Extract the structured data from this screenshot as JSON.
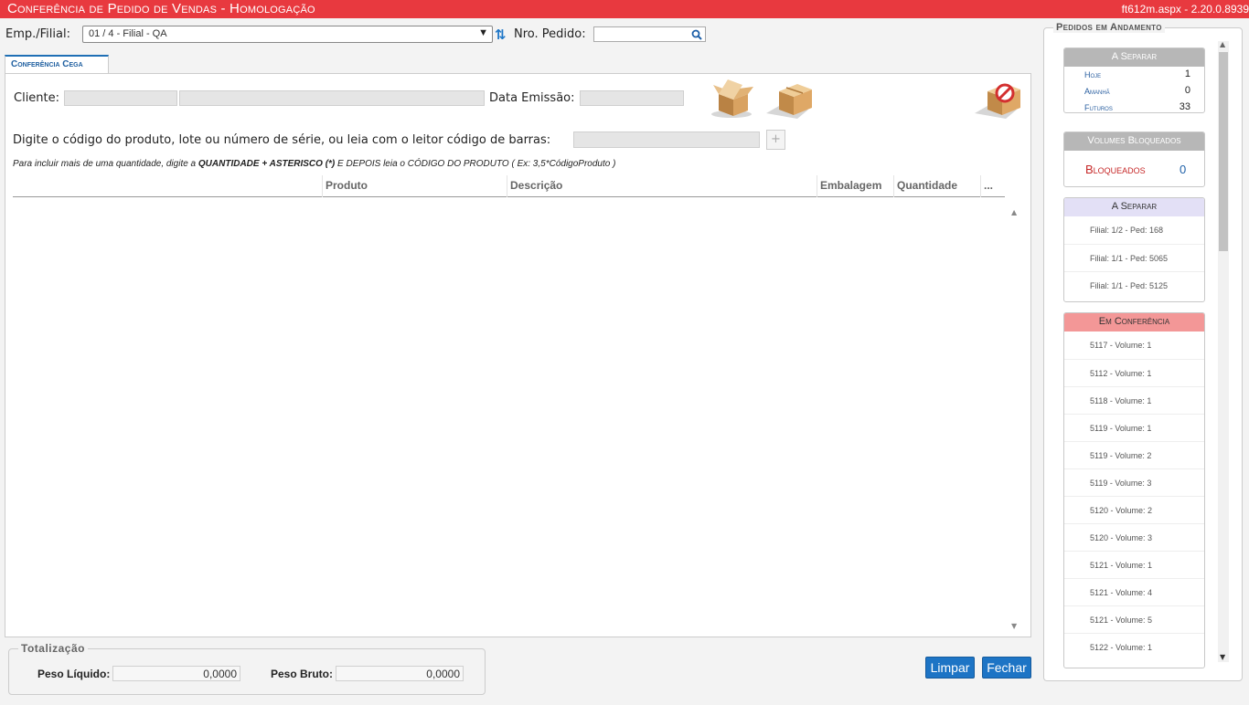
{
  "titlebar": {
    "title": "Conferência de Pedido de Vendas  - Homologação",
    "version": "ft612m.aspx - 2.20.0.8939"
  },
  "header": {
    "emp_filial_label": "Emp./Filial:",
    "emp_filial_value": "01 / 4 - Filial - QA",
    "nro_pedido_label": "Nro. Pedido:",
    "nro_pedido_value": ""
  },
  "tabs": [
    {
      "label": "Conferência Cega"
    }
  ],
  "form": {
    "cliente_label": "Cliente:",
    "data_emissao_label": "Data Emissão:",
    "barcode_label": "Digite o código do produto, lote ou número de série, ou leia com o leitor código de barras:",
    "add_label": "+",
    "hint_pre": "Para incluir mais de uma quantidade, digite a ",
    "hint_bold1": "QUANTIDADE + ASTERISCO (*)",
    "hint_mid": " E DEPOIS leia o CÓDIGO DO PRODUTO ( Ex: 3,5*CódigoProduto )"
  },
  "icons": [
    "open-box-icon",
    "closed-box-icon",
    "blocked-box-icon"
  ],
  "grid": {
    "columns": [
      "Produto",
      "Descrição",
      "Embalagem",
      "Quantidade",
      "..."
    ]
  },
  "totalizacao": {
    "legend": "Totalização",
    "peso_liquido_label": "Peso Líquido:",
    "peso_liquido_value": "0,0000",
    "peso_bruto_label": "Peso Bruto:",
    "peso_bruto_value": "0,0000"
  },
  "buttons": {
    "limpar": "Limpar",
    "fechar": "Fechar"
  },
  "sidebar": {
    "title": "Pedidos em Andamento",
    "a_separar_summary": {
      "header": "A Separar",
      "rows": [
        {
          "label": "Hoje",
          "count": "1"
        },
        {
          "label": "Amanhã",
          "count": "0"
        },
        {
          "label": "Futuros",
          "count": "33"
        }
      ]
    },
    "volumes_bloqueados": {
      "header": "Volumes Bloqueados",
      "label": "Bloqueados",
      "count": "0"
    },
    "a_separar_list": {
      "header": "A Separar",
      "items": [
        "Filial: 1/2 - Ped: 168",
        "Filial: 1/1 - Ped: 5065",
        "Filial: 1/1 - Ped: 5125"
      ]
    },
    "em_conferencia": {
      "header": "Em Conferência",
      "items": [
        "5117 - Volume: 1",
        "5112 - Volume: 1",
        "5118 - Volume: 1",
        "5119 - Volume: 1",
        "5119 - Volume: 2",
        "5119 - Volume: 3",
        "5120 - Volume: 2",
        "5120 - Volume: 3",
        "5121 - Volume: 1",
        "5121 - Volume: 4",
        "5121 - Volume: 5",
        "5122 - Volume: 1"
      ]
    }
  },
  "colors": {
    "titlebar": "#e8393f",
    "primary_button": "#1d74c5",
    "bloqueados": "#c62828"
  }
}
